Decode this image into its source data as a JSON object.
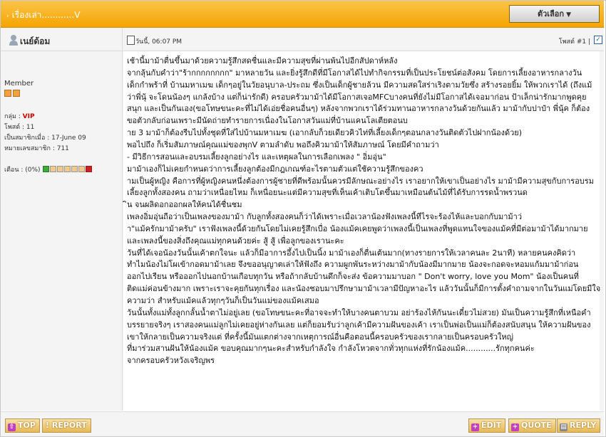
{
  "header": {
    "title": "เรื่องเล่า............V",
    "tools_label": "ตัวเลือก"
  },
  "user": {
    "name": "เนย์ด้อม",
    "rank": "Member",
    "group_label": "กลุ่ม :",
    "group_value": "VIP",
    "posts_label": "โพสต์ : 11",
    "joined_label": "เป็นสมาชิกเมื่อ : 17-June 09",
    "member_no_label": "หมายเลขสมาชิก : 711",
    "warn_label": "เตือน : (0%)"
  },
  "post": {
    "date": "วันนี้, 06:07 PM",
    "number": "โพสต์ #1 |",
    "lines": [
      "เช้านี้มาม้าตื่นขึ้นมาด้วยความรู้สึกสดชื่นและมีความสุขที่ผ่านพ้นไปอีกสัปดาห์หลัง",
      "จากลุ้นกับคำว่า\"ร้ากกกกกกกก\" มาหลายวัน และยิ่งรู้สึกดีที่มีโอกาสได้ไปทำกิจกรรมที่เป็นประโยชน์ต่อสังคม โดยการเลี้ยงอาหารกลางวัน",
      "เด็กกำพร้าที่ บ้านมหาเมฆ เด็กๆอยู่ในวัยอนุบาล-ประถม ซึ่งเป็นเด็กผู้ชายล้วน มีความสดใสร่าเริงตามวัยซึ่ง สร้างรอยยิ้ม ให้พวกเราได้ (ถึงแม้",
      "ว่าพี่นุ้ จะโดนน้องๆ แกล้งบ้าง แต่ก็น่ารักดี) ครอบครัวมาม้าได้มีโอกาสเจอMFCบางคนที่ยังไม่มีโอกาสได้เจอมาก่อน ป้าเล็กน่ารักมากพูดคุย",
      "สนุก และเป็นกันเอง(ขอโทษขนะคะที่ไม่ได้เอ่ยชื่อคนอื่นๆ) หลังจากพวกเราได้ร่วมทานอาหารกลางวันด้วยกันแล้ว มาม้ากับปาป๋า พี่นุ้ค ก็ต้อง",
      "ขอตัวกลับก่อนเพราะมีนัดถ่ายทำรายการเนื่องในโอกาสวันแม่ที่บ้านแคนโลเตียตอนบ",
      "าย 3 มาม้าก็ต้องรีบไปทั้งชุดที่ใส่ไปบ้านมหาเมฆ (เอากลับก็วยเดียวคิวไท่ที่เลี้ยงเด็กๆตอนกลางวันติดตัวไปฝากน้องด้วย)",
      "พอไปถึง ก็เริ่มสัมภาษณ์คุณแม่ของพุกV ตามลำดับ พอถึงคิวมาม้าให้สัมภาษณ์ โดยมีคำถามว่า",
      "- มีวิธีการสอนและอบรมเลี้ยงลูกอย่างไร และเหตุผลในการเลือกเพลง \" อิ่มอุ่น\"",
      "มาม้าเองก็ไม่เคยกำหนดว่าการเลี้ยงลูกต้องมีกฎเกณฑ์อะไรตามตัวแต่ใช้ความรู้สึกของคว",
      "ามเป็นผู้หญิง คือการที่ผู้หญิงคนหนึ่งต้องการผู้ชายที่ดีพร้อมนั้นควรมีลักษณะอย่างไร เราอยากให้เขาเป็นอย่างไร มาม้ามีความสุขกับการอบรม",
      "เลี้ยงลูกทั้งสองคน ถามว่าเหนื่อยไหม ก็เหนื่อยนะแต่มีความสุขที่เห็นเค้าเติบโตขึ้นมาเหมือนต้นไม้ที่ได้รับการรดน้ำพรวนด",
      "ิน จนผลิดอกออกผลให้คนได้ชื่นชม",
      "เพลงอิ่มอุ่นถือว่าเป็นเพลงของมาม้า กับลูกทั้งสองคนก็ว่าได้เพราะเมื่อเวลาน้องฟังเพลงนี้ทีไรจะร้องไห้และบอกกับมาม้าว่",
      "า\"แม้ครักมาม้าครับ\" เราฟังเพลงนี้ด้วยกันโดยไม่เคยรู้สึกเบื่อ น้องแม้คเคยพูดว่าเพลงนี้เป็นเพลงที่พูดแทนใจของแม้คที่มีต่อมาม้าได้มากมาย",
      "และเพลงนี้ของสิ่งถึงคุณแม่ทุกคนด้วยค่ะ สู้ สู้ เพื่อลูกของเรานะคะ",
      "วันที่ได้เจอน้องวันนั้นเค้าตกใจนะ แล้วก็มีอาการอึ้งไปเป็นนิ้ง มาม้าเองก็ตื่นเต้นมาก(ทางรายการให้เวลาคนละ 2นาที) หลายคนคงคิดว่า",
      "ทำไมน้องไม่โผเข้ากอดมาม้าเลย จึงขออนุญาตเล่าให้ฟังถึง ความผูกพันระหว่างมาม้ากับน้องมีมากมาย น้องจะกอดจะหอมแก้มมาม้าก่อน",
      "ออกไปเรียน หรือออกไปนอกบ้านเกือบทุกวัน หรือถ้ากลับบ้านดึกก็จะส่ง ข้อความมาบอก \" Don't worry, love you Mom\" น้องเป็นคนที่",
      "ติดแม่ค่อนข้างมาก เพราะเราจะคุยกันทุกเรื่อง และน้องชอบมาปรึกษามาม้าเวลามีปัญหาอะไร แล้ววันนั้นก็มีการตั้งคำถามจากในวันแม่โดยมีใจ",
      "ความว่า สำหรับแม้คแล้วทุกๆวันก็เป็นวันแม่ของแม้คเสมอ",
      "วันนั้นทั้งแม่ทั้งลูกกลั้นน้ำตาไม่อยู่เลย (ขอโทษขนะคะที่อาจจะทำให้บางคนตาบวม อย่าร้องไห้กันนะเดี๋ยวไม่สวย) มันเป็นความรู้สึกที่เหนือคำ",
      "บรรยายจริงๆ เราสองคนแม่ลูกไม่เคยอยู่ห่างกันเลย แต่ก็ยอมรับว่าลูกเค้ามีความฝันของเค้า เราเป็นพ่อเป็นแม่ก็ต้องสนับสนุน ให้ความฝันของ",
      "เขาให้กลายเป็นความจริงแต่ ที่ครั้งนี้มันแตกต่างจากเหตุการณ์อื่นคือตอนนี้ครอบครัวของเรากลายเป็นครอบครัวใหญ่",
      "ที่มาร่วมสานฝันให้น้องแม้ค ขอบคุณมากๆนะคะสำหรับกำลังใจ กำลังโหวตจากทั่วทุกแห่งที่รักน้องแม้ค............รักทุกคนค่ะ",
      "จากครอบครัวหวังเจริญพร"
    ]
  },
  "footer": {
    "top_label": "TOP",
    "report_label": "! REPORT",
    "edit_label": "EDIT",
    "quote_label": "QUOTE",
    "reply_label": "REPLY"
  },
  "colors": {
    "header_orange": "#f5a400",
    "vip_red": "#cc0000",
    "button_gold": "#e7b952"
  }
}
